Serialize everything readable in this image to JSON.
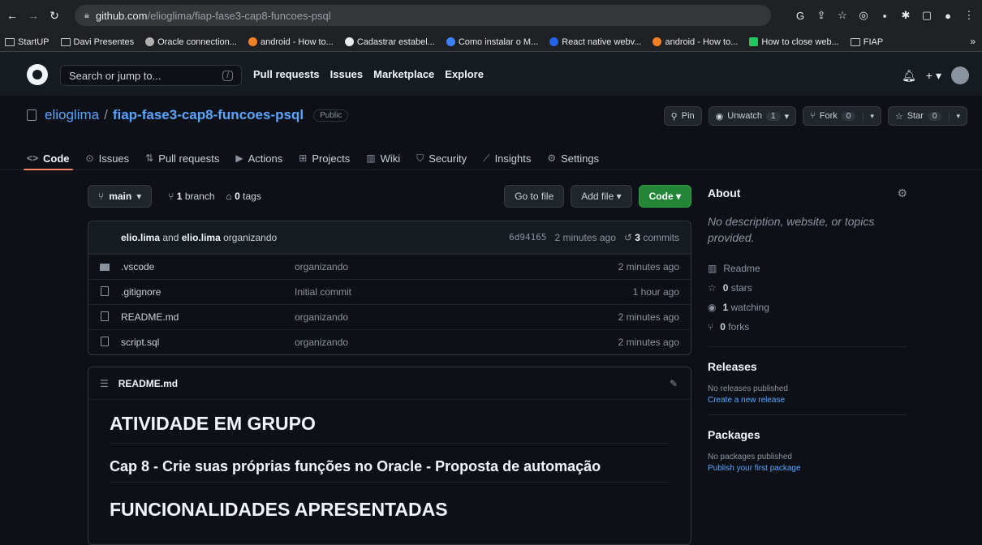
{
  "browser": {
    "url_host": "github.com",
    "url_path": "/elioglima/fiap-fase3-cap8-funcoes-psql",
    "bookmarks": [
      "StartUP",
      "Davi Presentes",
      "Oracle connection...",
      "android - How to...",
      "Cadastrar estabel...",
      "Como instalar o M...",
      "React native webv...",
      "android - How to...",
      "How to close web...",
      "FIAP"
    ],
    "more": "»"
  },
  "header": {
    "search_placeholder": "Search or jump to...",
    "slash": "/",
    "nav": [
      "Pull requests",
      "Issues",
      "Marketplace",
      "Explore"
    ],
    "plus": "+ ▾"
  },
  "repo": {
    "owner": "elioglima",
    "sep": "/",
    "name": "fiap-fase3-cap8-funcoes-psql",
    "visibility": "Public",
    "pin": "Pin",
    "unwatch": "Unwatch",
    "unwatch_count": "1",
    "fork": "Fork",
    "fork_count": "0",
    "star": "Star",
    "star_count": "0"
  },
  "tabs": [
    "Code",
    "Issues",
    "Pull requests",
    "Actions",
    "Projects",
    "Wiki",
    "Security",
    "Insights",
    "Settings"
  ],
  "branch": {
    "name": "main",
    "branch_count": "1",
    "branch_label": "branch",
    "tag_count": "0",
    "tag_label": "tags",
    "go_to_file": "Go to file",
    "add_file": "Add file ▾",
    "code": "Code ▾"
  },
  "commit": {
    "author1": "elio.lima",
    "and": "and",
    "author2": "elio.lima",
    "message": "organizando",
    "sha": "6d94165",
    "age": "2 minutes ago",
    "count": "3",
    "count_label": "commits"
  },
  "files": [
    {
      "name": ".vscode",
      "type": "folder",
      "message": "organizando",
      "age": "2 minutes ago"
    },
    {
      "name": ".gitignore",
      "type": "file",
      "message": "Initial commit",
      "age": "1 hour ago"
    },
    {
      "name": "README.md",
      "type": "file",
      "message": "organizando",
      "age": "2 minutes ago"
    },
    {
      "name": "script.sql",
      "type": "file",
      "message": "organizando",
      "age": "2 minutes ago"
    }
  ],
  "readme": {
    "filename": "README.md",
    "h1": "ATIVIDADE EM GRUPO",
    "h2": "Cap 8 - Crie suas próprias funções no Oracle - Proposta de automação",
    "h1b": "FUNCIONALIDADES APRESENTADAS"
  },
  "about": {
    "title": "About",
    "description": "No description, website, or topics provided.",
    "readme": "Readme",
    "stars_count": "0",
    "stars_label": "stars",
    "watching_count": "1",
    "watching_label": "watching",
    "forks_count": "0",
    "forks_label": "forks"
  },
  "releases": {
    "title": "Releases",
    "none": "No releases published",
    "link": "Create a new release"
  },
  "packages": {
    "title": "Packages",
    "none": "No packages published",
    "link": "Publish your first package"
  },
  "colors": {
    "link": "#58a6ff",
    "code_button": "#238636",
    "active_tab": "#f78166"
  }
}
